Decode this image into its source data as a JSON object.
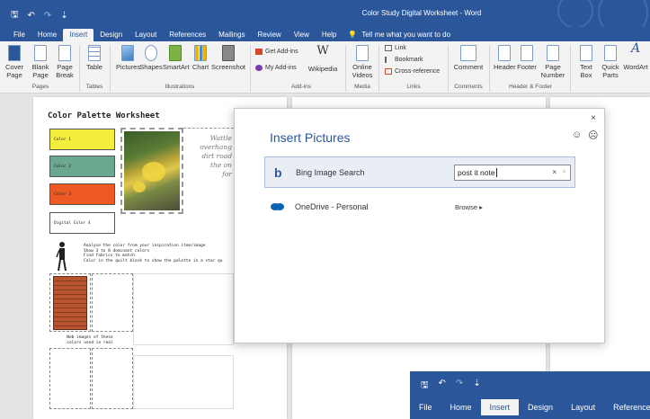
{
  "titlebar": {
    "quick_access": [
      "🖫",
      "↶",
      "↷",
      "⇣"
    ],
    "doc_title": "Color Study Digital Worksheet  -  Word"
  },
  "tabs": [
    {
      "label": "File",
      "active": false
    },
    {
      "label": "Home",
      "active": false
    },
    {
      "label": "Insert",
      "active": true
    },
    {
      "label": "Design",
      "active": false
    },
    {
      "label": "Layout",
      "active": false
    },
    {
      "label": "References",
      "active": false
    },
    {
      "label": "Mailings",
      "active": false
    },
    {
      "label": "Review",
      "active": false
    },
    {
      "label": "View",
      "active": false
    },
    {
      "label": "Help",
      "active": false
    }
  ],
  "tell_me": {
    "icon": "lightbulb-icon",
    "glyph": "💡",
    "text": "Tell me what you want to do"
  },
  "ribbon": {
    "cover_page": "Cover\nPage",
    "blank_page": "Blank\nPage",
    "page_break": "Page\nBreak",
    "table": "Table",
    "pictures": "Pictures",
    "shapes": "Shapes",
    "smartart": "SmartArt",
    "chart": "Chart",
    "screenshot": "Screenshot",
    "get_addins": "Get Add-ins",
    "my_addins": "My Add-ins",
    "wikipedia": "Wikipedia",
    "online_videos": "Online\nVideos",
    "link": "Link",
    "bookmark": "Bookmark",
    "cross_reference": "Cross-reference",
    "comment": "Comment",
    "header": "Header",
    "footer": "Footer",
    "page_number": "Page\nNumber",
    "text_box": "Text\nBox",
    "quick_parts": "Quick\nParts",
    "wordart": "WordArt",
    "groups": {
      "pages": "Pages",
      "tables": "Tables",
      "illustrations": "Illustrations",
      "addins": "Add-ins",
      "media": "Media",
      "links": "Links",
      "comments": "Comments",
      "header_footer": "Header & Footer"
    }
  },
  "document": {
    "worksheet_title": "Color Palette Worksheet",
    "swatches": [
      {
        "label": "Color 1",
        "color": "#f4ef3e"
      },
      {
        "label": "Color 2",
        "color": "#6aa88f"
      },
      {
        "label": "Color 3",
        "color": "#ed5a24"
      },
      {
        "label": "Digital Color 4",
        "color": "#ffffff"
      }
    ],
    "side_text": [
      "Wattle",
      "overhang",
      "dirt road",
      "the on",
      "for"
    ],
    "instructions": [
      "Analyse the color from your inspiration item/image",
      "Show 3 to 8 dominant colors",
      "Find fabrics to match",
      "Color in the quilt block to show the palette in a star qu"
    ],
    "web_caption": "Web images of these\ncolors used in real"
  },
  "dialog": {
    "title": "Insert Pictures",
    "close": "×",
    "smile": "☺",
    "frown": "☹",
    "bing": {
      "logo": "b",
      "label": "Bing Image Search",
      "search_value": "post it note",
      "clear": "×",
      "search_glyph": "⌕"
    },
    "onedrive": {
      "label": "OneDrive - Personal",
      "browse": "Browse ▸"
    }
  },
  "second_window": {
    "quick_access": [
      "🖫",
      "↶",
      "↷",
      "⇣"
    ],
    "tabs": [
      {
        "label": "File",
        "active": false
      },
      {
        "label": "Home",
        "active": false
      },
      {
        "label": "Insert",
        "active": true
      },
      {
        "label": "Design",
        "active": false
      },
      {
        "label": "Layout",
        "active": false
      },
      {
        "label": "References",
        "active": false
      }
    ]
  },
  "colors": {
    "word_blue": "#2b579a",
    "ribbon_bg": "#f3f3f3",
    "dialog_selected": "#e9eef5"
  }
}
